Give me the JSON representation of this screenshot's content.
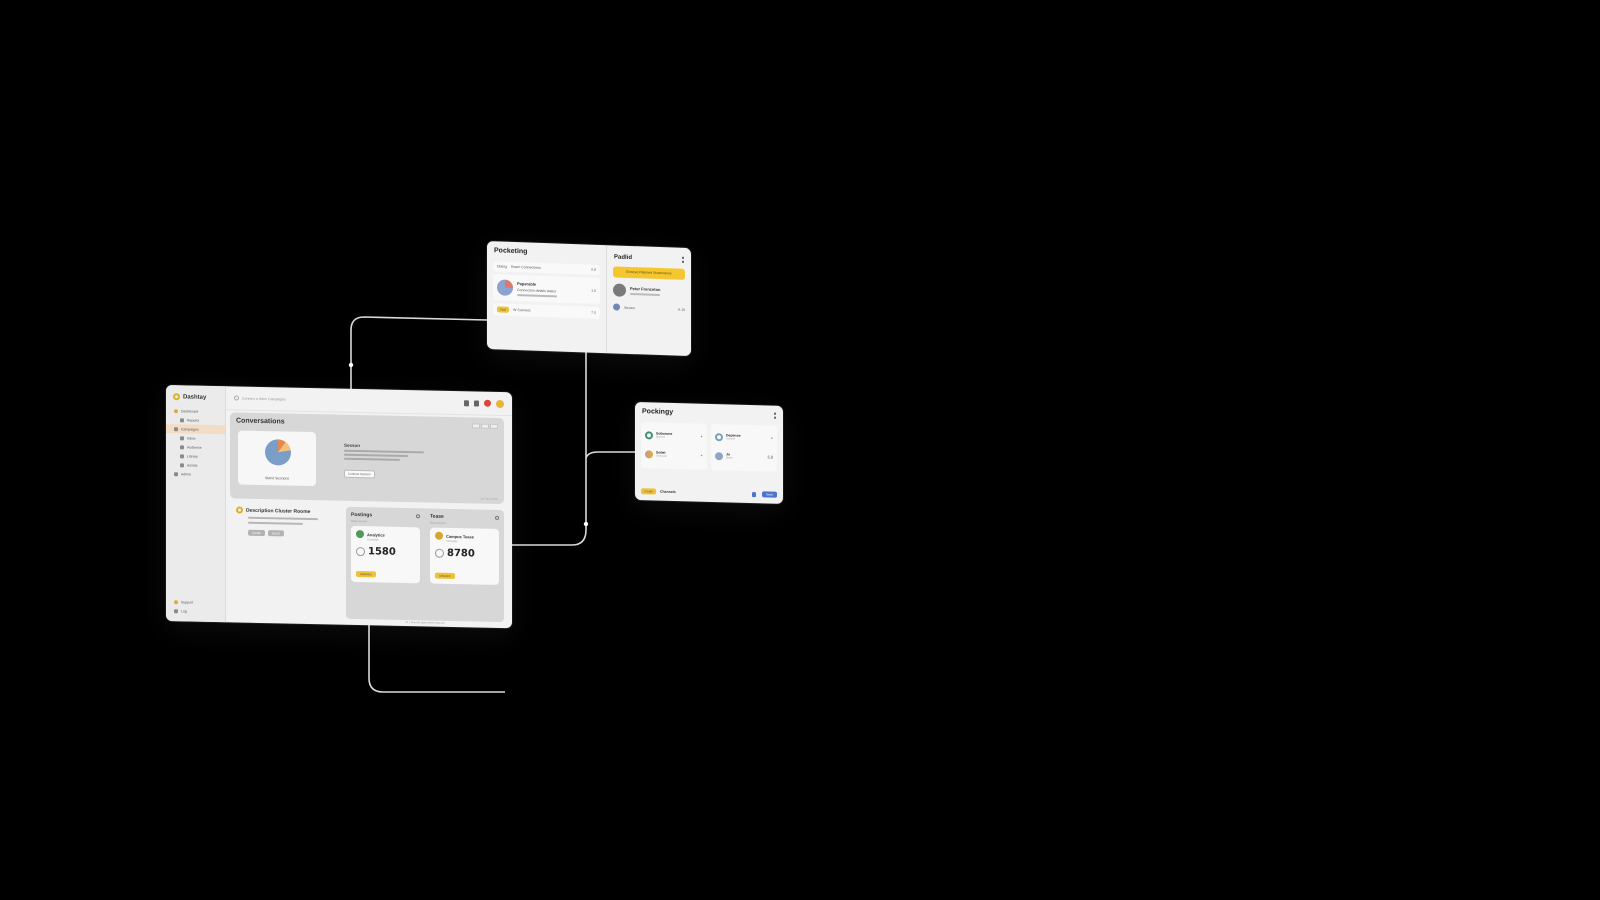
{
  "colors": {
    "background": "#000000",
    "accent_yellow": "#f0c23a",
    "accent_blue": "#4a76d1",
    "alert_red": "#d9453c",
    "connector": "#d9d9d9"
  },
  "main_window": {
    "brand": "Dashtay",
    "search_placeholder": "Connect a Stem Campaigns",
    "top_icons": [
      "bell-icon",
      "shield-icon",
      "alert-icon",
      "avatar"
    ],
    "sidebar": {
      "items": [
        {
          "label": "Dashboard",
          "icon": "home-icon",
          "active": false
        },
        {
          "label": "Reports",
          "icon": "grid-icon",
          "active": false
        },
        {
          "label": "Campaigns",
          "icon": "flag-icon",
          "active": true
        },
        {
          "label": "Inbox",
          "icon": "inbox-icon",
          "active": false
        },
        {
          "label": "Audience",
          "icon": "users-icon",
          "active": false
        },
        {
          "label": "Library",
          "icon": "book-icon",
          "active": false
        },
        {
          "label": "Assets",
          "icon": "folder-icon",
          "active": false
        },
        {
          "label": "Admin",
          "icon": "gear-icon",
          "active": false
        }
      ],
      "bottom": [
        {
          "label": "Support",
          "icon": "help-icon"
        },
        {
          "label": "Log",
          "icon": "logout-icon"
        }
      ]
    },
    "summary": {
      "title": "Conversations",
      "pie_label": "Stand Sessions",
      "text_heading": "Sesson",
      "button": "Connect Session",
      "footer": "ld 4 10 d. 0d 51"
    },
    "campaign": {
      "title": "Description Cluster Roome",
      "buttons": [
        "Create",
        "Quest"
      ]
    },
    "metrics": [
      {
        "header": "Postings",
        "sub": "Stats overview",
        "name": "Analytics",
        "name_sub": "Campaign",
        "value": "1580",
        "button": "Advance"
      },
      {
        "header": "Tease",
        "sub": "Stats overview",
        "name": "Campus Tease",
        "name_sub": "Campaign",
        "value": "8780",
        "button": "Advance"
      }
    ],
    "status": "Ol 1 Seed all rights online-reserved"
  },
  "panel_top": {
    "title": "Pocketing",
    "rows": [
      {
        "label": "Dialog",
        "text": "Room Connections",
        "value": "0.8"
      },
      {
        "label": "Paperable",
        "text": "Connection details status",
        "value": "1.0"
      },
      {
        "tag": "Task",
        "label": "W Connect",
        "value": "7.5"
      }
    ],
    "right_title": "Padlid",
    "banner": "Ennovo Planned Sustenance",
    "right_item": "Peter Frenceton",
    "right_foot_label": "Stream",
    "right_foot_value": "6.18"
  },
  "panel_right": {
    "title": "Pockingy",
    "left_items": [
      {
        "name": "Soborone",
        "sub": "Shoo 01",
        "action": "+"
      },
      {
        "name": "Soilet",
        "sub": "Tecnocrat",
        "action": "+"
      }
    ],
    "right_items": [
      {
        "name": "Depense",
        "sub": "Lecrone",
        "action": "×"
      },
      {
        "name": "Ju",
        "sub": "Stone",
        "action": "5.8"
      }
    ],
    "foot_tag": "Create",
    "foot_label": "Channels",
    "foot_button": "Save"
  }
}
